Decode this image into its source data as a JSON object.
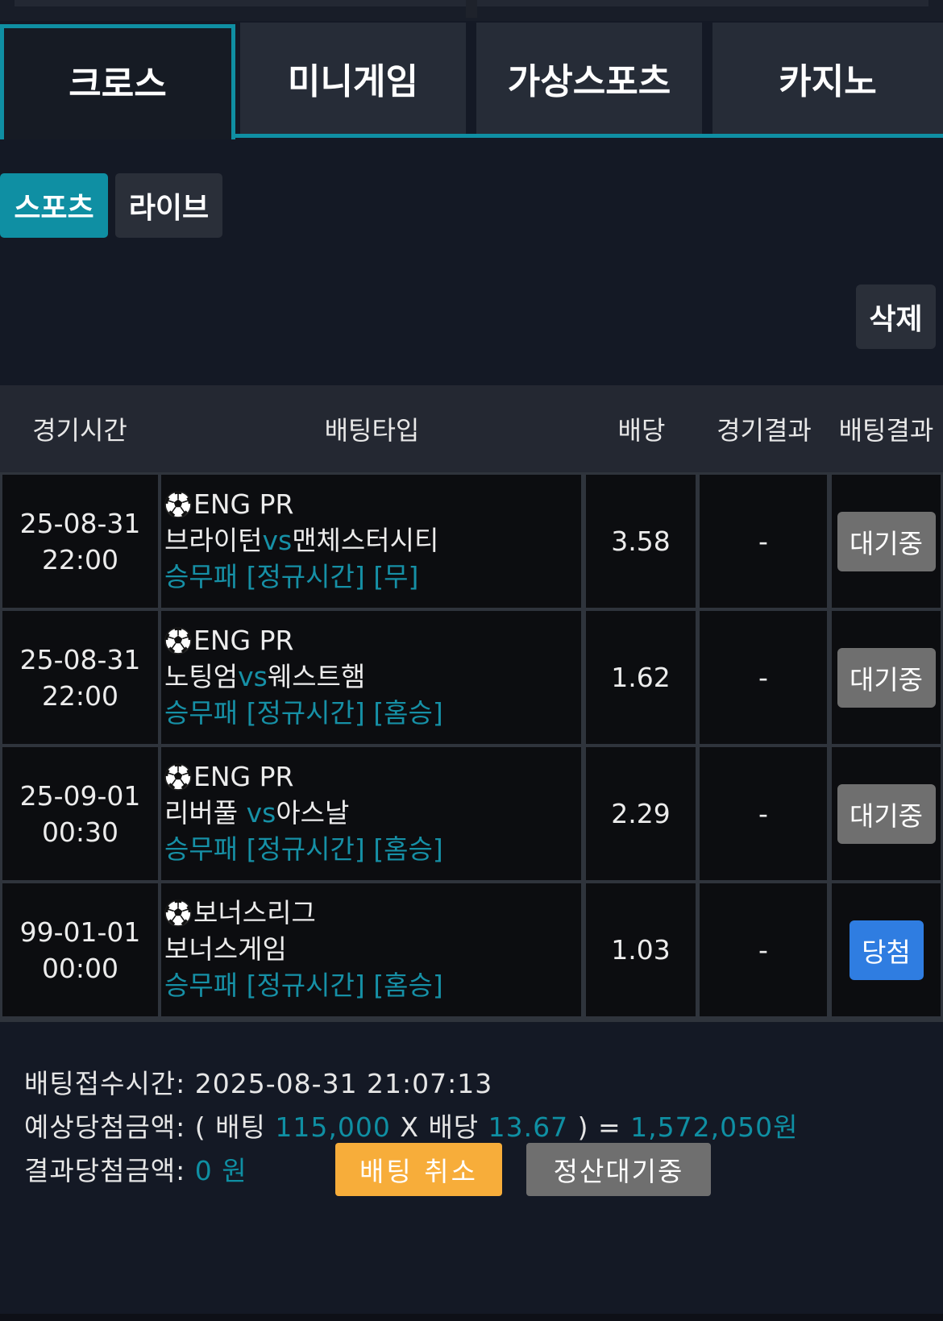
{
  "tabs": [
    {
      "label": "크로스",
      "active": true
    },
    {
      "label": "미니게임",
      "active": false
    },
    {
      "label": "가상스포츠",
      "active": false
    },
    {
      "label": "카지노",
      "active": false
    }
  ],
  "subtabs": [
    {
      "label": "스포츠",
      "active": true
    },
    {
      "label": "라이브",
      "active": false
    }
  ],
  "delete_label": "삭제",
  "table": {
    "headers": [
      "경기시간",
      "배팅타입",
      "배당",
      "경기결과",
      "배팅결과"
    ],
    "rows": [
      {
        "date": "25-08-31",
        "time": "22:00",
        "league": "ENG PR",
        "home": "브라이턴",
        "vs": "vs",
        "away": "맨체스터시티",
        "pick": "승무패 [정규시간] [무]",
        "odds": "3.58",
        "result": "-",
        "status": "대기중",
        "status_type": "pending"
      },
      {
        "date": "25-08-31",
        "time": "22:00",
        "league": "ENG PR",
        "home": "노팅엄",
        "vs": "vs",
        "away": "웨스트햄",
        "pick": "승무패 [정규시간] [홈승]",
        "odds": "1.62",
        "result": "-",
        "status": "대기중",
        "status_type": "pending"
      },
      {
        "date": "25-09-01",
        "time": "00:30",
        "league": "ENG PR",
        "home": "리버풀 ",
        "vs": "vs",
        "away": "아스날",
        "pick": "승무패 [정규시간] [홈승]",
        "odds": "2.29",
        "result": "-",
        "status": "대기중",
        "status_type": "pending"
      },
      {
        "date": "99-01-01",
        "time": "00:00",
        "league": "보너스리그",
        "home": "보너스게임",
        "vs": "",
        "away": "",
        "pick": "승무패 [정규시간] [홈승]",
        "odds": "1.03",
        "result": "-",
        "status": "당첨",
        "status_type": "win"
      }
    ]
  },
  "footer": {
    "bet_time_label": "배팅접수시간:",
    "bet_time_value": "2025-08-31 21:07:13",
    "expected_label": "예상당첨금액:",
    "open_paren": "( 배팅",
    "bet_amount": "115,000",
    "x_label": "X 배당",
    "total_odds": "13.67",
    "close_paren": ") =",
    "expected_amount": "1,572,050원",
    "result_label": "결과당첨금액:",
    "result_amount": "0 원"
  },
  "buttons": {
    "cancel_label": "배팅 취소",
    "pending_label": "정산대기중"
  },
  "colors": {
    "accent": "#0f8fa3",
    "cancel": "#f7ad3a",
    "win": "#2f7de1",
    "pending": "#6f6f6f"
  }
}
